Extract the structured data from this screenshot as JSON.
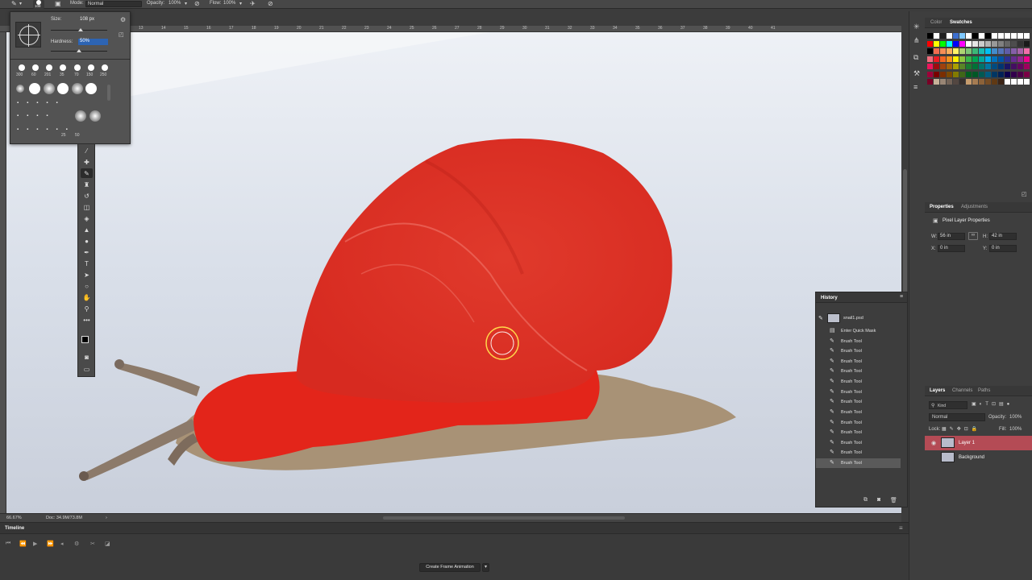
{
  "options_bar": {
    "brush_size_badge": "108",
    "mode_label": "Mode:",
    "mode_value": "Normal",
    "opacity_label": "Opacity:",
    "opacity_value": "100%",
    "flow_label": "Flow:",
    "flow_value": "100%"
  },
  "ruler_numbers": [
    "13",
    "14",
    "15",
    "16",
    "17",
    "18",
    "19",
    "20",
    "21",
    "22",
    "23",
    "24",
    "25",
    "26",
    "27",
    "28",
    "29",
    "30",
    "31",
    "32",
    "33",
    "34",
    "35",
    "36",
    "37",
    "38",
    "39",
    "40",
    "41"
  ],
  "brush_panel": {
    "size_label": "Size:",
    "size_value": "108 px",
    "hardness_label": "Hardness:",
    "hardness_value": "50%",
    "preset_sizes": [
      "300",
      "60",
      "201",
      "35",
      "70",
      "150",
      "250"
    ],
    "bottom_sizes": [
      "25",
      "50"
    ]
  },
  "status": {
    "zoom": "66.67%",
    "doc": "Doc: 34.9M/73.8M"
  },
  "color_panel": {
    "tab_color": "Color",
    "tab_swatches": "Swatches"
  },
  "swatch_colors": [
    [
      "#000000",
      "#ffffff",
      "#202020",
      "#ffffff",
      "#3c6fcf",
      "#7ec8ff",
      "#ffffff",
      "#000000",
      "#ffffff",
      "#000000",
      "#ffffff",
      "#ffffff",
      "#ffffff",
      "#ffffff",
      "#ffffff",
      "#ffffff"
    ],
    [
      "#ff0000",
      "#ffff00",
      "#00ff00",
      "#00ffff",
      "#0000ff",
      "#ff00ff",
      "#ffffff",
      "#e6e6e6",
      "#cccccc",
      "#b3b3b3",
      "#999999",
      "#808080",
      "#666666",
      "#4d4d4d",
      "#333333",
      "#1a1a1a"
    ],
    [
      "#000000",
      "#f26c4f",
      "#f68e55",
      "#fbaf5c",
      "#fff467",
      "#acd372",
      "#7cc576",
      "#3bb878",
      "#1abbb4",
      "#00bff3",
      "#438ccb",
      "#5574b9",
      "#605ca8",
      "#855fa8",
      "#a763a9",
      "#f06ea9"
    ],
    [
      "#f26d7d",
      "#ed1c24",
      "#f26522",
      "#f7941d",
      "#fff200",
      "#8dc63f",
      "#39b54a",
      "#00a651",
      "#00a99d",
      "#00aeef",
      "#0072bc",
      "#0054a6",
      "#2e3192",
      "#662d91",
      "#92278f",
      "#ec008c"
    ],
    [
      "#ed145b",
      "#9e0b0f",
      "#a0410d",
      "#a36209",
      "#aba000",
      "#598527",
      "#1a7b30",
      "#007236",
      "#00746b",
      "#0076a3",
      "#004b80",
      "#003471",
      "#1b1464",
      "#440e62",
      "#630460",
      "#9e005d"
    ],
    [
      "#9e0039",
      "#790000",
      "#7b2e00",
      "#7d4900",
      "#827b00",
      "#406618",
      "#005e20",
      "#005826",
      "#005952",
      "#005b7f",
      "#003663",
      "#002157",
      "#0d004c",
      "#32004b",
      "#4b0049",
      "#7b0046"
    ],
    [
      "#7a0026",
      "#c7b299",
      "#998675",
      "#736357",
      "#534741",
      "#37302d",
      "#c69c6d",
      "#a67c52",
      "#8c6239",
      "#754c24",
      "#603913",
      "#3c2415",
      "#ffffff",
      "#ffffff",
      "#ffffff",
      "#ffffff"
    ]
  ],
  "properties_panel": {
    "tab_properties": "Properties",
    "tab_adjustments": "Adjustments",
    "section_title": "Pixel Layer Properties",
    "w_label": "W:",
    "w_value": "56 in",
    "h_label": "H:",
    "h_value": "42 in",
    "x_label": "X:",
    "x_value": "0 in",
    "y_label": "Y:",
    "y_value": "0 in"
  },
  "history_panel": {
    "title": "History",
    "snapshot": "snail1.psd",
    "items": [
      "Enter Quick Mask",
      "Brush Tool",
      "Brush Tool",
      "Brush Tool",
      "Brush Tool",
      "Brush Tool",
      "Brush Tool",
      "Brush Tool",
      "Brush Tool",
      "Brush Tool",
      "Brush Tool",
      "Brush Tool",
      "Brush Tool",
      "Brush Tool"
    ]
  },
  "layers_panel": {
    "tab_layers": "Layers",
    "tab_channels": "Channels",
    "tab_paths": "Paths",
    "filter_kind": "Kind",
    "blend_mode": "Normal",
    "opacity_label": "Opacity:",
    "opacity_value": "100%",
    "lock_label": "Lock:",
    "fill_label": "Fill:",
    "fill_value": "100%",
    "layers": [
      {
        "name": "Layer 1",
        "selected": true
      },
      {
        "name": "Background",
        "selected": false
      }
    ]
  },
  "timeline": {
    "title": "Timeline",
    "create_button": "Create Frame Animation"
  }
}
